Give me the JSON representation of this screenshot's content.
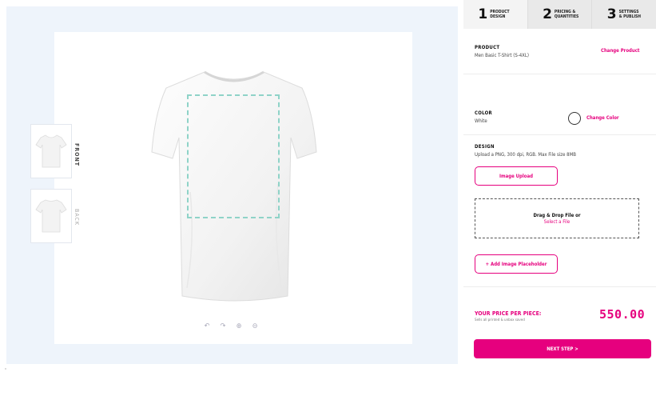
{
  "preview": {
    "views": [
      {
        "label": "FRONT"
      },
      {
        "label": "BACK"
      }
    ],
    "tools": [
      "↶",
      "↷",
      "⊕",
      "⊖"
    ]
  },
  "tabs": [
    {
      "num": "1",
      "text": "PRODUCT DESIGN"
    },
    {
      "num": "2",
      "text": "PRICING & QUANTITIES"
    },
    {
      "num": "3",
      "text": "SETTINGS & PUBLISH"
    }
  ],
  "product": {
    "label": "PRODUCT",
    "value": "Men Basic T-Shirt (S-4XL)",
    "link": "Change Product"
  },
  "color": {
    "label": "COLOR",
    "value": "White",
    "link": "Change Color",
    "swatch": "#ffffff"
  },
  "design": {
    "label": "DESIGN",
    "value": "Upload a PNG, 300 dpi, RGB. Max File size 8MB",
    "upload_button": "Image Upload",
    "drop_line1": "Drag & Drop File or",
    "drop_line2": "Select a File",
    "placeholder_button": "+ Add Image Placeholder"
  },
  "price": {
    "label": "YOUR PRICE PER PIECE:",
    "sub": "Sells all printed & unbox saved",
    "value": "550.00"
  },
  "next_button": "NEXT STEP >",
  "colors": {
    "accent": "#e6007e",
    "stage_bg": "#eef4fb",
    "print_area": "#8fd3c8"
  }
}
